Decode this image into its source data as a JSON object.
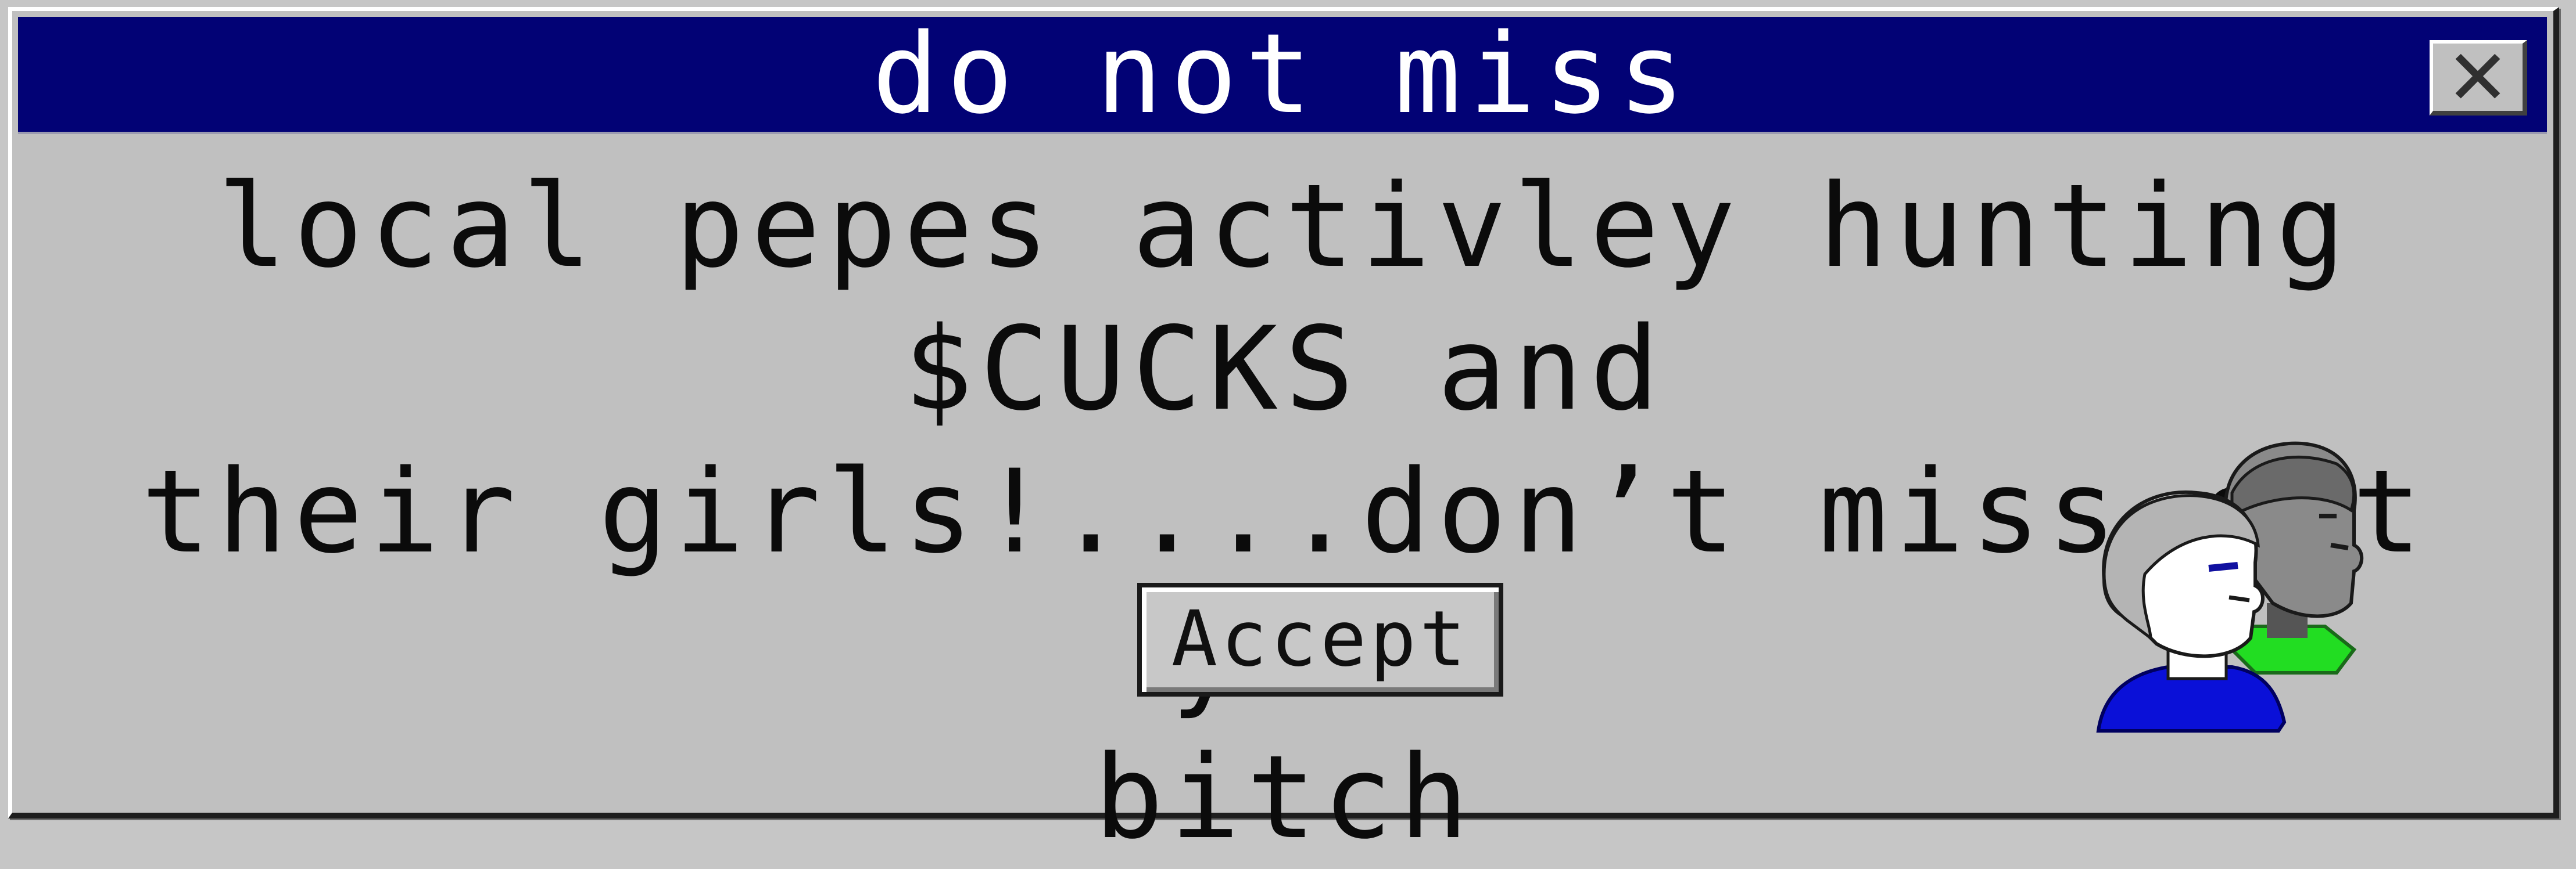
{
  "dialog": {
    "title": "do not miss",
    "close_icon": "close-icon",
    "message_lines": [
      "local pepes activley hunting $CUCKS and",
      "their girls!....don’t miss out you",
      "bitch"
    ],
    "accept_label": "Accept",
    "icon": "users-icon"
  },
  "colors": {
    "titlebar": "#020275",
    "title_text": "#ffffff",
    "dialog_bg": "#c0c0c0",
    "icon_front_shirt": "#0a10d8",
    "icon_back_shirt": "#22dd22"
  }
}
